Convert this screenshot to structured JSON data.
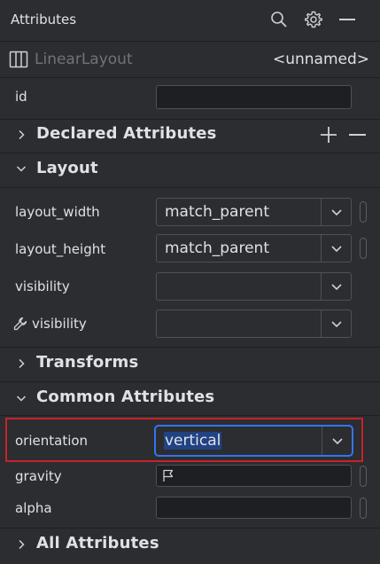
{
  "panel": {
    "title": "Attributes",
    "component_name": "LinearLayout",
    "component_id_value": "<unnamed>"
  },
  "id_row": {
    "label": "id",
    "value": ""
  },
  "sections": {
    "declared": "Declared Attributes",
    "layout": "Layout",
    "transforms": "Transforms",
    "common": "Common Attributes",
    "all": "All Attributes"
  },
  "layout_rows": [
    {
      "label": "layout_width",
      "value": "match_parent"
    },
    {
      "label": "layout_height",
      "value": "match_parent"
    },
    {
      "label": "visibility",
      "value": ""
    },
    {
      "label": "visibility",
      "value": ""
    }
  ],
  "common_rows": [
    {
      "label": "orientation",
      "value": "vertical"
    },
    {
      "label": "gravity",
      "value": ""
    },
    {
      "label": "alpha",
      "value": ""
    }
  ],
  "colors": {
    "background": "#2b2d30",
    "focus_border": "#3574f0",
    "selection": "#214283",
    "highlight_frame": "#c7222a"
  },
  "icons": [
    "search-icon",
    "gear-icon",
    "minimize-icon",
    "layout-columns-icon",
    "add-icon",
    "remove-icon",
    "chevron-right-icon",
    "chevron-down-icon",
    "wrench-icon",
    "flag-icon"
  ]
}
